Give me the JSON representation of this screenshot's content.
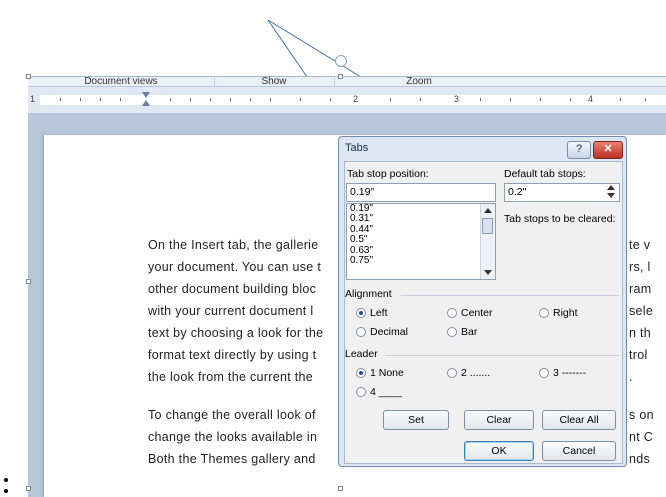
{
  "ribbon": {
    "groups": [
      "Document views",
      "Show",
      "Zoom"
    ]
  },
  "ruler": {
    "numbers": [
      "1",
      "2",
      "3",
      "4"
    ]
  },
  "document": {
    "lines": [
      "On the Insert tab, the gallerie",
      "your document. You can use t",
      "other document building bloc",
      "with your current document l",
      "text by choosing a look for the",
      "format text directly by using t",
      "the look from the current the",
      "To change the overall look of",
      "change the looks available in",
      "Both the Themes gallery and"
    ],
    "right_fragments": [
      "te v",
      "rs, l",
      "ram",
      "sele",
      "n th",
      "trol",
      ".",
      "s on",
      "nt C",
      "nds"
    ]
  },
  "dialog": {
    "title": "Tabs",
    "help_label": "?",
    "close_label": "✕",
    "tab_stop_label": "Tab stop position:",
    "tab_stop_value": "0.19\"",
    "tab_stops_list": [
      "0.19\"",
      "0.31\"",
      "0.44\"",
      "0.5\"",
      "0.63\"",
      "0.75\""
    ],
    "default_tab_label": "Default tab stops:",
    "default_tab_value": "0.2\"",
    "to_clear_label": "Tab stops to be cleared:",
    "alignment_label": "Alignment",
    "alignment_options": [
      "Left",
      "Center",
      "Right",
      "Decimal",
      "Bar"
    ],
    "alignment_selected": "Left",
    "leader_label": "Leader",
    "leader_options": [
      "1 None",
      "2 .......",
      "3 -------",
      "4 ____"
    ],
    "leader_selected": "1 None",
    "set_label": "Set",
    "clear_label": "Clear",
    "clear_all_label": "Clear All",
    "ok_label": "OK",
    "cancel_label": "Cancel"
  },
  "colors": {
    "accent": "#1f4fa8",
    "close_button": "#c0392b",
    "callout_arrow": "#3d6fb6"
  }
}
